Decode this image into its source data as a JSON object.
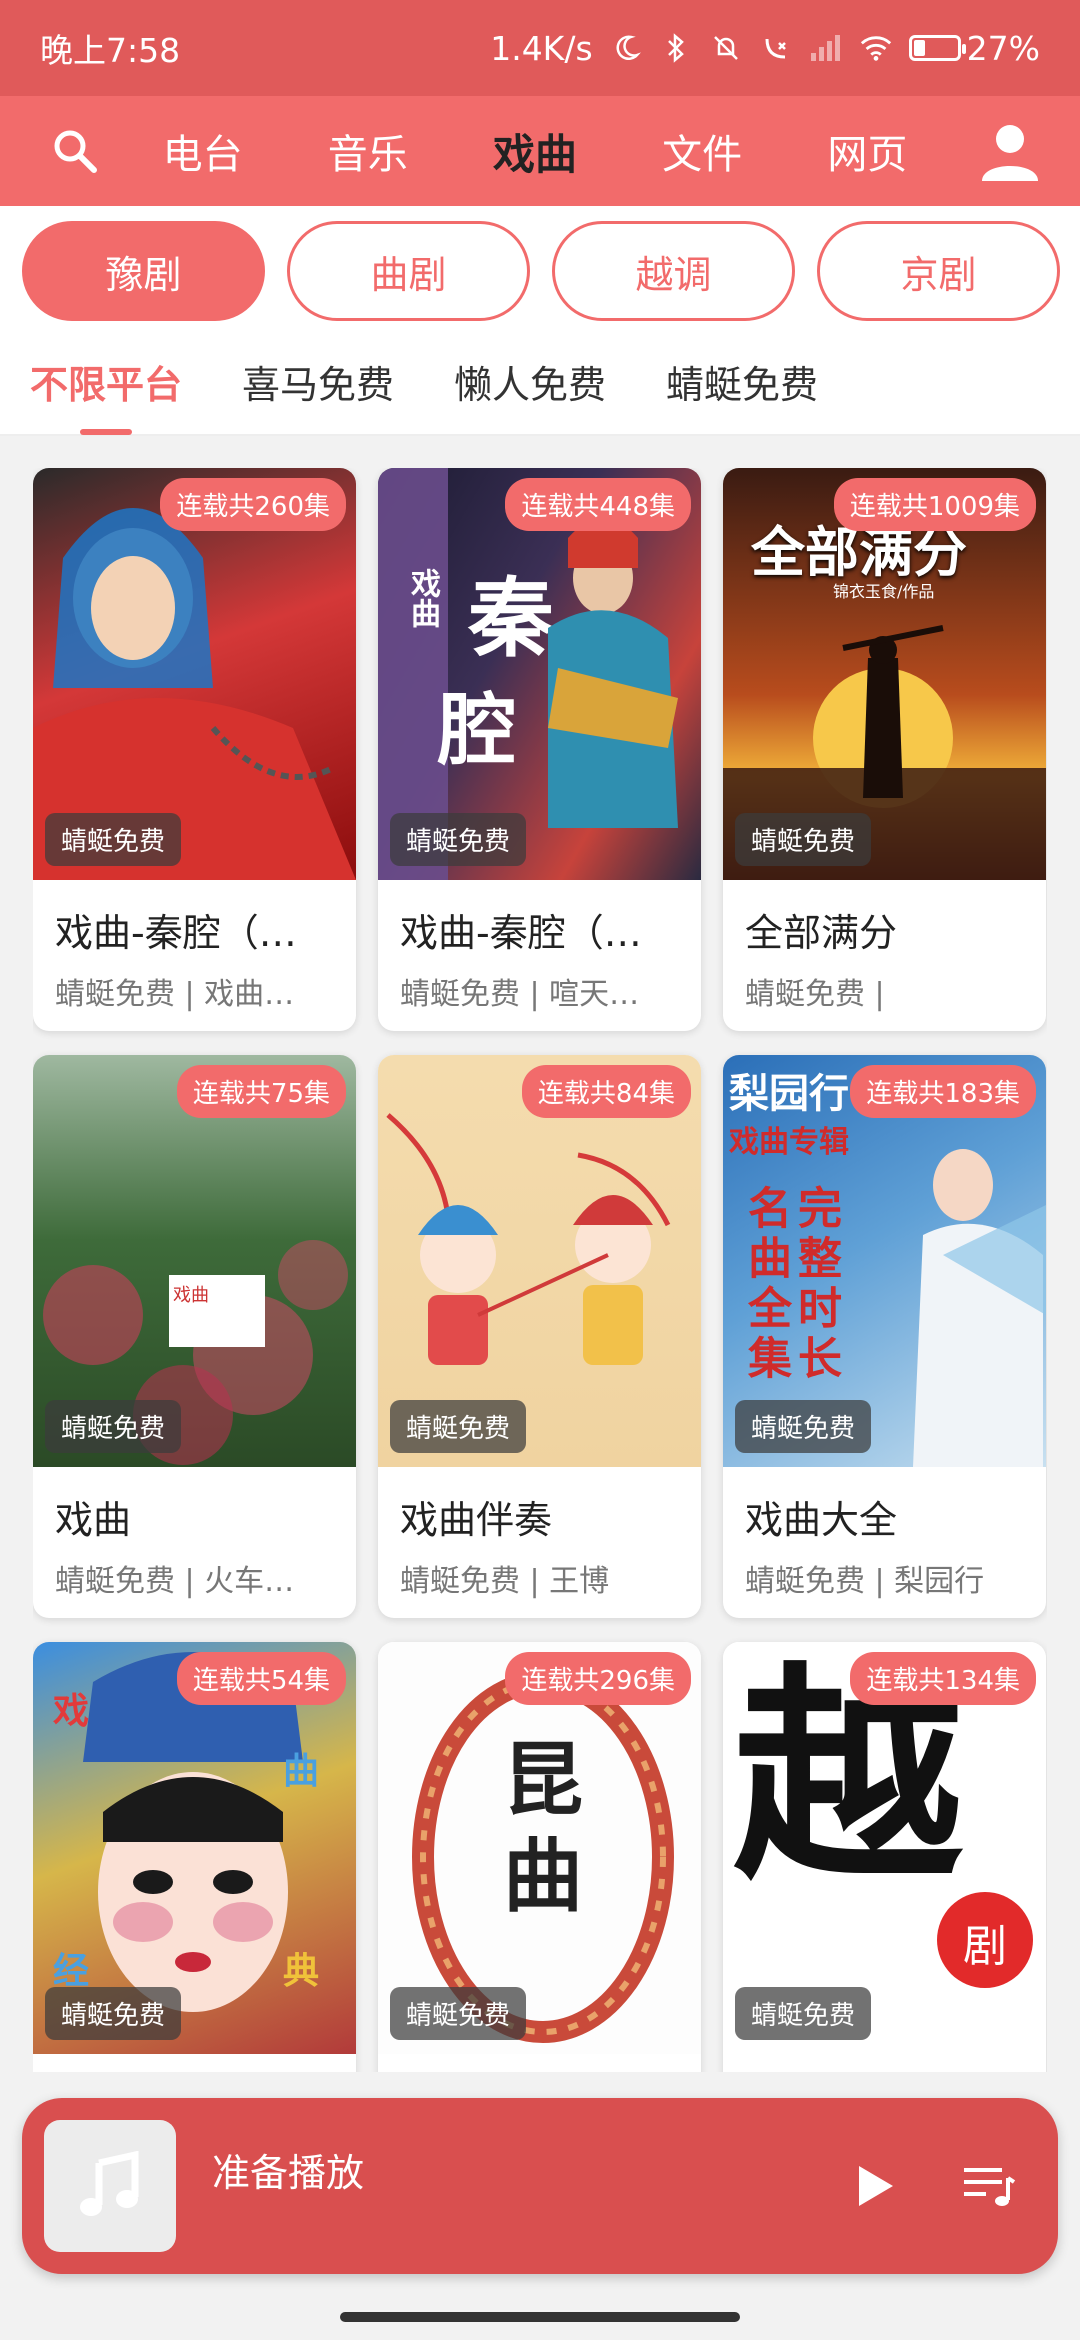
{
  "status_bar": {
    "time": "晚上7:58",
    "net_speed": "1.4K/s",
    "battery": "27%",
    "battery_level": 0.27
  },
  "top_nav": {
    "tabs": [
      {
        "label": "电台"
      },
      {
        "label": "音乐"
      },
      {
        "label": "戏曲",
        "active": true
      },
      {
        "label": "文件"
      },
      {
        "label": "网页"
      }
    ]
  },
  "categories": [
    {
      "label": "豫剧",
      "active": true
    },
    {
      "label": "曲剧"
    },
    {
      "label": "越调"
    },
    {
      "label": "京剧"
    }
  ],
  "platforms": [
    {
      "label": "不限平台",
      "active": true
    },
    {
      "label": "喜马免费"
    },
    {
      "label": "懒人免费"
    },
    {
      "label": "蜻蜓免费"
    }
  ],
  "cards": [
    {
      "title": "戏曲-秦腔（二）",
      "meta": "蜻蜓免费 | 戏曲…",
      "episodes": "连载共260集",
      "source": "蜻蜓免费"
    },
    {
      "title": "戏曲-秦腔（一）",
      "meta": "蜻蜓免费 | 喧天…",
      "episodes": "连载共448集",
      "source": "蜻蜓免费",
      "art": [
        "戏曲",
        "秦",
        "腔"
      ]
    },
    {
      "title": "全部满分",
      "meta": "蜻蜓免费 |",
      "episodes": "连载共1009集",
      "source": "蜻蜓免费",
      "art": [
        "全部满分",
        "锦衣玉食/作品"
      ]
    },
    {
      "title": "戏曲",
      "meta": "蜻蜓免费 | 火车…",
      "episodes": "连载共75集",
      "source": "蜻蜓免费",
      "art": [
        "戏曲"
      ]
    },
    {
      "title": "戏曲伴奏",
      "meta": "蜻蜓免费 | 王博",
      "episodes": "连载共84集",
      "source": "蜻蜓免费"
    },
    {
      "title": "戏曲大全",
      "meta": "蜻蜓免费 | 梨园行",
      "episodes": "连载共183集",
      "source": "蜻蜓免费",
      "art": [
        "梨园行",
        "戏曲专辑",
        "完整时长",
        "名曲全集"
      ]
    },
    {
      "title": "",
      "meta": "",
      "episodes": "连载共54集",
      "source": "蜻蜓免费",
      "art": [
        "戏",
        "曲",
        "经",
        "典"
      ]
    },
    {
      "title": "",
      "meta": "",
      "episodes": "连载共296集",
      "source": "蜻蜓免费",
      "art": [
        "昆曲"
      ]
    },
    {
      "title": "",
      "meta": "",
      "episodes": "连载共134集",
      "source": "蜻蜓免费",
      "art": [
        "越",
        "剧"
      ]
    }
  ],
  "player": {
    "status": "准备播放"
  },
  "colors": {
    "brand": "#f26b6b",
    "status_bar": "#e05a5a",
    "player": "#d94f4f"
  }
}
